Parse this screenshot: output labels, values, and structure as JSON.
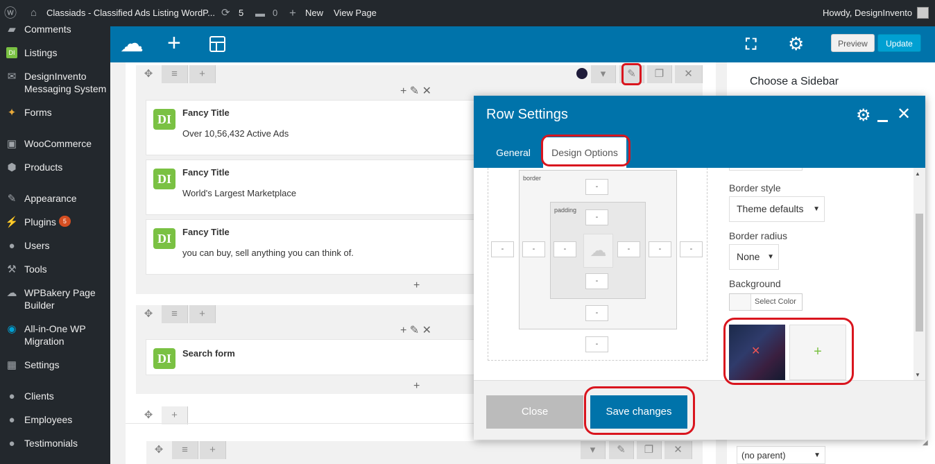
{
  "adminbar": {
    "site_title": "Classiads - Classified Ads Listing WordP...",
    "updates_count": "5",
    "comments_count": "0",
    "new_label": "New",
    "view_page_label": "View Page",
    "howdy": "Howdy, DesignInvento"
  },
  "sidebar": {
    "items": [
      {
        "label": "Comments",
        "icon": "comment-icon"
      },
      {
        "label": "Listings",
        "icon": "di-icon"
      },
      {
        "label": "DesignInvento Messaging System",
        "icon": "mail-icon"
      },
      {
        "label": "Forms",
        "icon": "forms-icon"
      },
      {
        "label": "WooCommerce",
        "icon": "woo-icon"
      },
      {
        "label": "Products",
        "icon": "products-icon"
      },
      {
        "label": "Appearance",
        "icon": "brush-icon"
      },
      {
        "label": "Plugins",
        "icon": "plugin-icon",
        "badge": "5"
      },
      {
        "label": "Users",
        "icon": "users-icon"
      },
      {
        "label": "Tools",
        "icon": "wrench-icon"
      },
      {
        "label": "WPBakery Page Builder",
        "icon": "cloud-icon"
      },
      {
        "label": "All-in-One WP Migration",
        "icon": "migration-icon"
      },
      {
        "label": "Settings",
        "icon": "settings-icon"
      },
      {
        "label": "Clients",
        "icon": "client-icon"
      },
      {
        "label": "Employees",
        "icon": "employees-icon"
      },
      {
        "label": "Testimonials",
        "icon": "testimonial-icon"
      }
    ]
  },
  "toolbar": {
    "preview_label": "Preview",
    "update_label": "Update"
  },
  "canvas": {
    "elements": [
      {
        "title": "Fancy Title",
        "subtitle": "Over 10,56,432 Active Ads"
      },
      {
        "title": "Fancy Title",
        "subtitle": "World's Largest Marketplace"
      },
      {
        "title": "Fancy Title",
        "subtitle": "you can buy, sell anything you can think of."
      },
      {
        "title": "Search form",
        "subtitle": ""
      }
    ],
    "badge_text": "DI"
  },
  "rightpanel": {
    "heading": "Choose a Sidebar",
    "parent_select": "(no parent)"
  },
  "modal": {
    "title": "Row Settings",
    "tabs": [
      "General",
      "Design Options"
    ],
    "box_labels": {
      "border": "border",
      "padding": "padding"
    },
    "dash": "-",
    "border_style_label": "Border style",
    "border_style_value": "Theme defaults",
    "border_radius_label": "Border radius",
    "border_radius_value": "None",
    "background_label": "Background",
    "select_color_label": "Select Color",
    "close_label": "Close",
    "save_label": "Save changes"
  },
  "colors": {
    "admin_dark": "#23282d",
    "wp_blue": "#0073aa",
    "di_green": "#7ac143",
    "highlight_red": "#d9151e"
  }
}
